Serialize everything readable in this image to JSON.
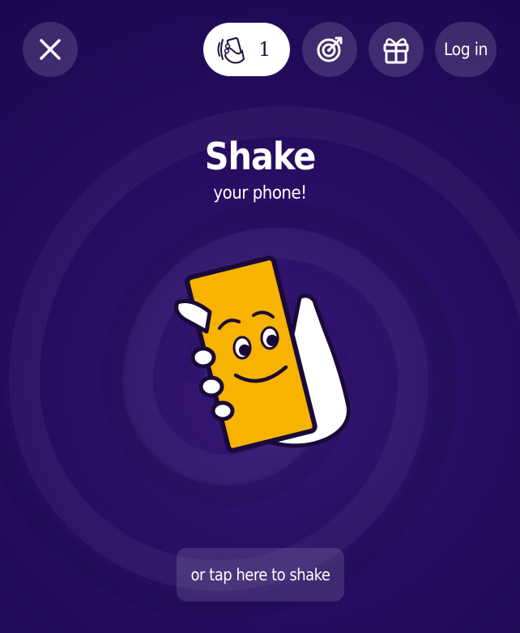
{
  "header": {
    "shake_count": "1",
    "login_label": "Log in"
  },
  "main": {
    "title": "Shake",
    "subtitle": "your phone!",
    "tap_button_label": "or tap here to shake"
  },
  "colors": {
    "background": "#240b5c",
    "phone": "#f8b300",
    "outline": "#1a0a3a",
    "hand": "#ffffff"
  },
  "icons": [
    "close-icon",
    "shake-hand-icon",
    "target-icon",
    "gift-icon"
  ]
}
